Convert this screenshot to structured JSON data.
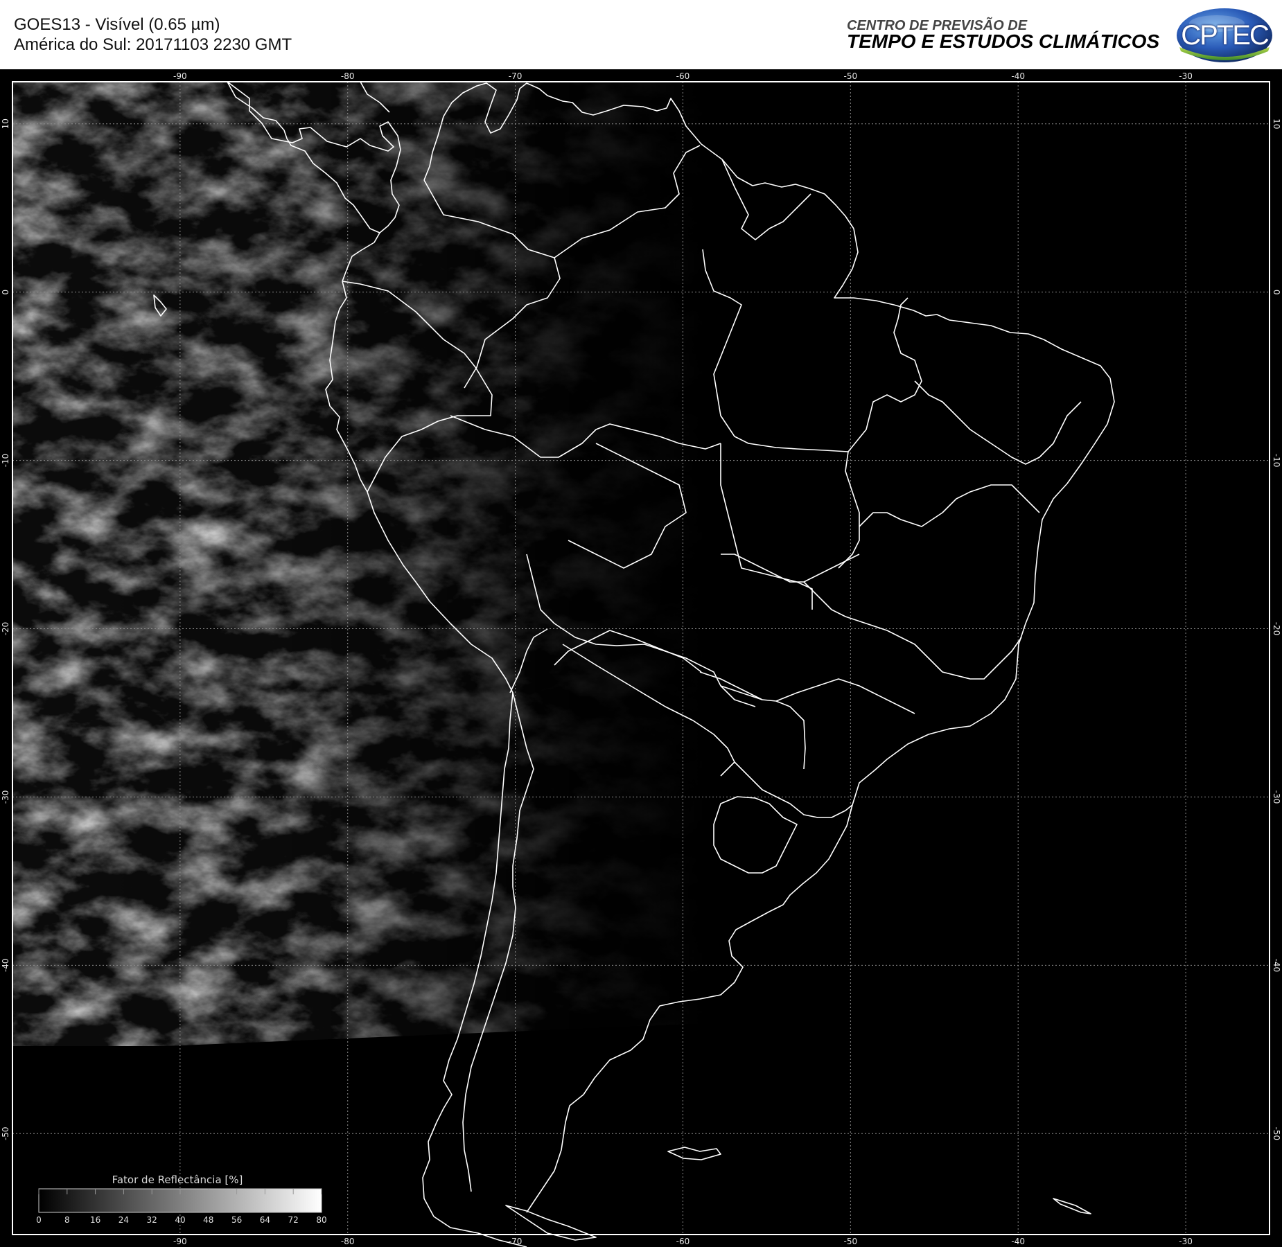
{
  "header": {
    "title_line1": "GOES13 - Visível (0.65 µm)",
    "title_line2": "América do Sul: 20171103 2230 GMT",
    "org_line1": "CENTRO DE PREVISÃO DE",
    "org_line2": "TEMPO E ESTUDOS CLIMÁTICOS",
    "logo_text": "CPTEC",
    "logo_icon": "cptec-globe-logo-icon"
  },
  "map": {
    "lon_ticks": [
      "-90",
      "-80",
      "-70",
      "-60",
      "-50",
      "-40",
      "-30"
    ],
    "lat_ticks": [
      "10",
      "0",
      "-10",
      "-20",
      "-30",
      "-40",
      "-50"
    ],
    "lon_range": [
      -100,
      -25
    ],
    "lat_range": [
      12.5,
      -56
    ],
    "colors": {
      "background": "#000000",
      "coastline": "#ffffff",
      "grid": "#8c8c8c"
    }
  },
  "colorbar": {
    "title": "Fator de Reflectância [%]",
    "ticks": [
      "0",
      "8",
      "16",
      "24",
      "32",
      "40",
      "48",
      "56",
      "64",
      "72",
      "80"
    ],
    "range": [
      0,
      80
    ]
  }
}
